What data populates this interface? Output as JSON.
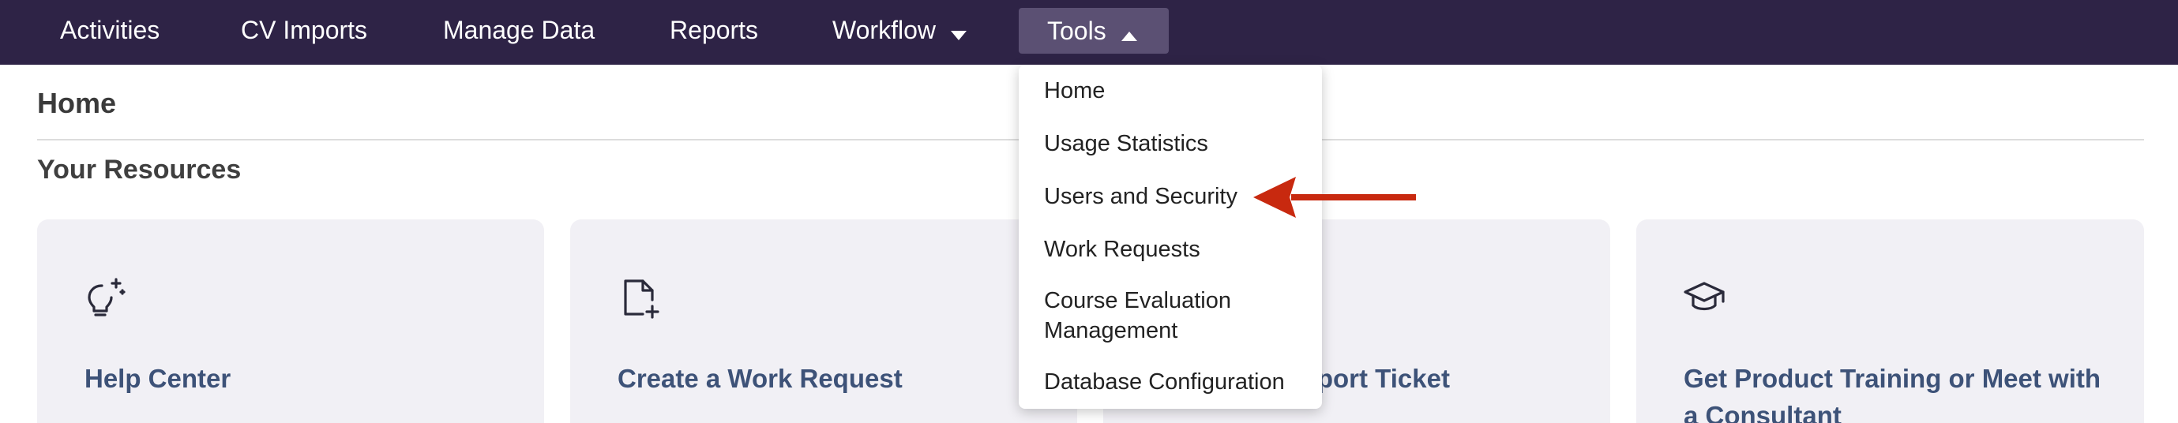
{
  "nav": {
    "items": [
      {
        "label": "Activities"
      },
      {
        "label": "CV Imports"
      },
      {
        "label": "Manage Data"
      },
      {
        "label": "Reports"
      },
      {
        "label": "Workflow",
        "caret": "down"
      },
      {
        "label": "Tools",
        "caret": "up",
        "open": true
      }
    ]
  },
  "page": {
    "title": "Home",
    "section_title": "Your Resources"
  },
  "cards": [
    {
      "title": "Help Center",
      "icon": "lightbulb-sparkle-icon"
    },
    {
      "title": "Create a Work Request",
      "icon": "file-plus-icon"
    },
    {
      "title": "Submit a Support Ticket",
      "icon": "ticket-icon"
    },
    {
      "title": "Get Product Training or Meet with a Consultant",
      "icon": "graduation-cap-icon"
    }
  ],
  "tools_menu": {
    "items": [
      {
        "label": "Home"
      },
      {
        "label": "Usage Statistics"
      },
      {
        "label": "Users and Security"
      },
      {
        "label": "Work Requests"
      },
      {
        "label": "Course Evaluation Management"
      },
      {
        "label": "Database Configuration"
      }
    ]
  },
  "colors": {
    "navbar_bg": "#2e2346",
    "nav_open_bg": "#5b5073",
    "card_bg": "#f1f0f5",
    "card_title": "#3d5278",
    "arrow": "#c8290f"
  }
}
